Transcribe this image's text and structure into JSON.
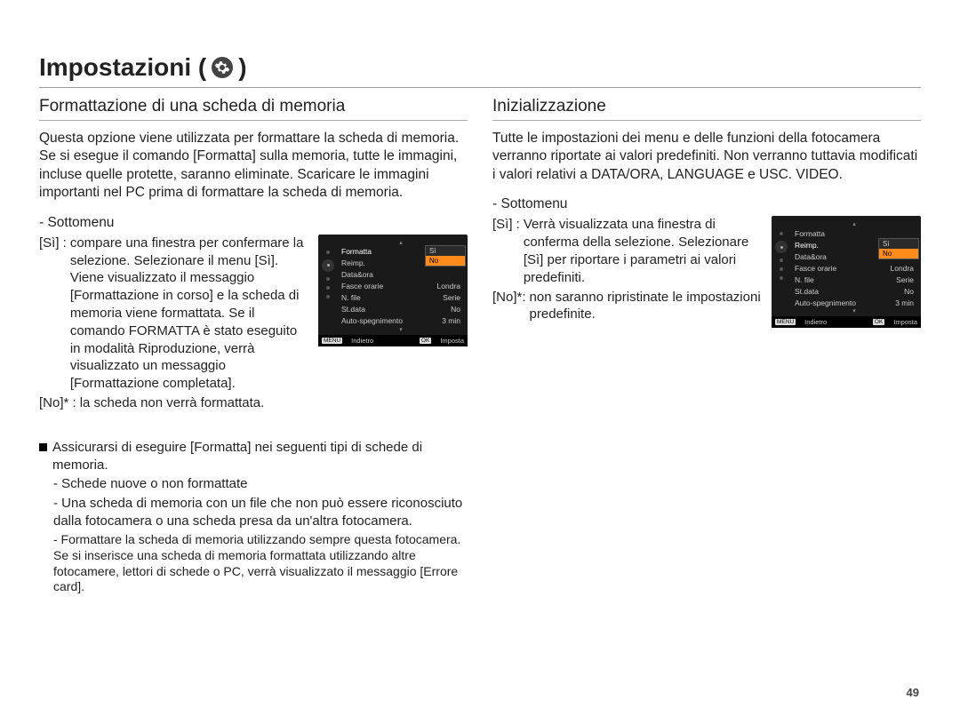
{
  "page": {
    "title_prefix": "Impostazioni (",
    "title_suffix": ")",
    "number": "49"
  },
  "left": {
    "heading": "Formattazione di una scheda di memoria",
    "intro": "Questa opzione viene utilizzata per formattare la scheda di memoria. Se si esegue il comando [Formatta] sulla memoria, tutte le immagini, incluse quelle protette, saranno eliminate. Scaricare le immagini importanti nel PC prima di formattare la scheda di memoria.",
    "submenu_label": "- Sottomenu",
    "si_key": "[Sì]   :",
    "si_val": "compare una finestra per confermare la selezione. Selezionare il menu [Sì]. Viene visualizzato il messaggio [Formattazione in corso] e la scheda di memoria viene formattata. Se il comando FORMATTA è stato eseguito in modalità Riproduzione, verrà visualizzato un messaggio [Formattazione completata].",
    "no_key": "[No]* :",
    "no_val": "la scheda non verrà formattata.",
    "notes_lead": "Assicurarsi di eseguire [Formatta] nei seguenti tipi di schede di memoria.",
    "note1": "- Schede nuove o non formattate",
    "note2": "- Una scheda di memoria con un file che non può essere riconosciuto dalla fotocamera o una scheda presa da un'altra fotocamera.",
    "note3": "- Formattare la scheda di memoria utilizzando sempre questa fotocamera. Se si inserisce una scheda di memoria formattata utilizzando altre fotocamere, lettori di schede o PC, verrà visualizzato il messaggio [Errore card]."
  },
  "right": {
    "heading": "Inizializzazione",
    "intro": "Tutte le impostazioni dei menu e delle funzioni della fotocamera verranno riportate ai valori predefiniti. Non verranno tuttavia modificati i valori relativi a DATA/ORA, LANGUAGE e USC. VIDEO.",
    "submenu_label": "- Sottomenu",
    "si_key": "[Sì]   :",
    "si_val": "Verrà visualizzata una finestra di conferma della selezione. Selezionare [Sì] per riportare i parametri ai valori predefiniti.",
    "no_key": "[No]*:",
    "no_val": "non saranno ripristinate le impostazioni predefinite."
  },
  "screenshot_left": {
    "menu": [
      {
        "label": "Formatta",
        "value": "",
        "selected": true
      },
      {
        "label": "Reimp.",
        "value": "No"
      },
      {
        "label": "Data&ora",
        "value": ""
      },
      {
        "label": "Fasce orarie",
        "value": "Londra"
      },
      {
        "label": "N. file",
        "value": "Serie"
      },
      {
        "label": "St.data",
        "value": "No"
      },
      {
        "label": "Auto-spegnimento",
        "value": "3 min"
      }
    ],
    "popup": [
      "Sì",
      "No"
    ],
    "popup_hl_index": 1,
    "footer_left_btn": "MENU",
    "footer_left": "Indietro",
    "footer_right_btn": "OK",
    "footer_right": "Imposta"
  },
  "screenshot_right": {
    "menu": [
      {
        "label": "Formatta",
        "value": ""
      },
      {
        "label": "Reimp.",
        "value": "",
        "selected": true
      },
      {
        "label": "Data&ora",
        "value": ""
      },
      {
        "label": "Fasce orarie",
        "value": "Londra"
      },
      {
        "label": "N. file",
        "value": "Serie"
      },
      {
        "label": "St.data",
        "value": "No"
      },
      {
        "label": "Auto-spegnimento",
        "value": "3 min"
      }
    ],
    "popup": [
      "Sì",
      "No"
    ],
    "popup_hl_index": 1,
    "footer_left_btn": "MENU",
    "footer_left": "Indietro",
    "footer_right_btn": "OK",
    "footer_right": "Imposta"
  }
}
